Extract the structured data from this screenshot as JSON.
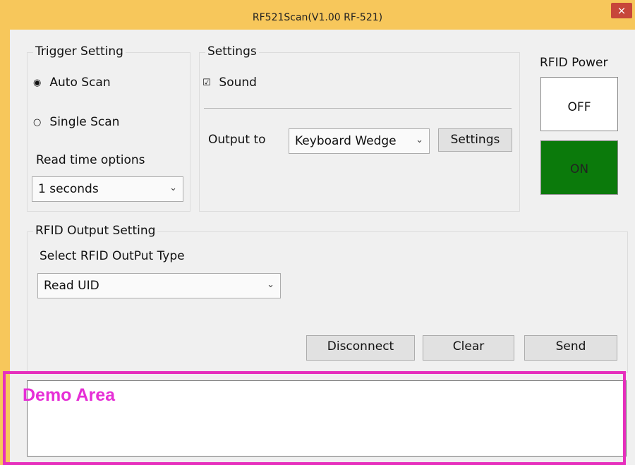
{
  "window": {
    "title": "RF521Scan(V1.00 RF-521)",
    "close_label": "×"
  },
  "trigger": {
    "legend": "Trigger Setting",
    "options": [
      {
        "label": "Auto Scan",
        "selected": true
      },
      {
        "label": "Single Scan",
        "selected": false
      }
    ],
    "read_time_label": "Read time options",
    "read_time_value": "1 seconds"
  },
  "settings": {
    "legend": "Settings",
    "sound_label": "Sound",
    "sound_checked": true,
    "output_label": "Output to",
    "output_value": "Keyboard Wedge",
    "settings_button": "Settings"
  },
  "rfid_power": {
    "label": "RFID Power",
    "off_label": "OFF",
    "on_label": "ON",
    "on_color": "#008000"
  },
  "rfid_output": {
    "legend": "RFID Output Setting",
    "type_label": "Select RFID OutPut Type",
    "type_value": "Read UID"
  },
  "buttons": {
    "disconnect": "Disconnect",
    "clear": "Clear",
    "send": "Send"
  },
  "annotation": {
    "demo_label": "Demo Area",
    "color": "#e62fd6"
  },
  "icons": {
    "radio_on": "◉",
    "radio_off": "○",
    "checkbox_checked": "☑",
    "dropdown": "⌄"
  }
}
